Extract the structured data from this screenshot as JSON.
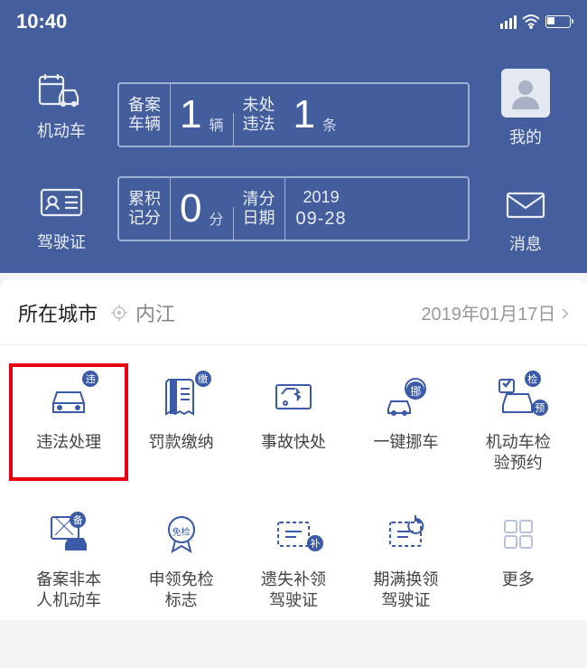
{
  "status": {
    "time": "10:40"
  },
  "nav": {
    "vehicle": "机动车",
    "license": "驾驶证",
    "mine": "我的",
    "messages": "消息"
  },
  "cards": {
    "top": {
      "left_l1": "备案",
      "left_l2": "车辆",
      "val1": "1",
      "unit1": "辆",
      "right_l1": "未处",
      "right_l2": "违法",
      "val2": "1",
      "unit2": "条"
    },
    "bottom": {
      "left_l1": "累积",
      "left_l2": "记分",
      "val1": "0",
      "unit1": "分",
      "right_l1": "清分",
      "right_l2": "日期",
      "year": "2019",
      "md": "09-28"
    }
  },
  "city": {
    "label": "所在城市",
    "name": "内江",
    "date": "2019年01月17日"
  },
  "badges": {
    "vio": "违",
    "pay": "缴",
    "move": "挪",
    "check": "检",
    "book": "预",
    "reg": "备",
    "exempt": "免检",
    "supp": "补"
  },
  "services": [
    {
      "label": "违法处理"
    },
    {
      "label": "罚款缴纳"
    },
    {
      "label": "事故快处"
    },
    {
      "label": "一键挪车"
    },
    {
      "label": "机动车检\n验预约"
    },
    {
      "label": "备案非本\n人机动车"
    },
    {
      "label": "申领免检\n标志"
    },
    {
      "label": "遗失补领\n驾驶证"
    },
    {
      "label": "期满换领\n驾驶证"
    },
    {
      "label": "更多"
    }
  ]
}
